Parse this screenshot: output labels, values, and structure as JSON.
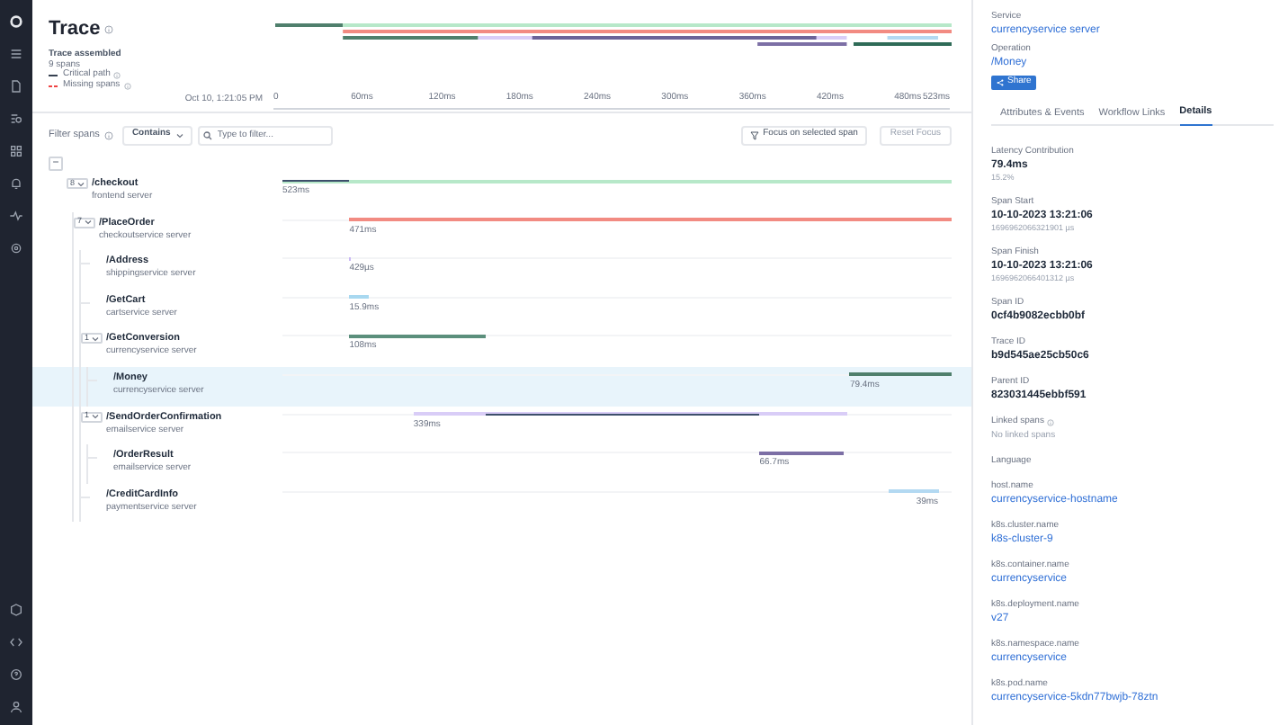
{
  "header": {
    "title": "Trace",
    "status": "Trace assembled",
    "span_count": "9 spans",
    "legend": [
      {
        "kind": "critical",
        "label": "Critical path"
      },
      {
        "kind": "missing",
        "label": "Missing spans"
      }
    ]
  },
  "timeline": {
    "start_time": "Oct 10, 1:21:05 PM",
    "ticks": [
      "0",
      "60ms",
      "120ms",
      "180ms",
      "240ms",
      "300ms",
      "360ms",
      "420ms",
      "480ms",
      "523ms"
    ]
  },
  "filter": {
    "label": "Filter spans",
    "mode": "Contains",
    "placeholder": "Type to filter...",
    "focus_button": "Focus on selected span",
    "reset_button": {
      "label": "Reset Focus",
      "disabled": true
    }
  },
  "collapse_all": "−",
  "spans": [
    {
      "name": "/checkout",
      "service": "frontend server",
      "count": "8",
      "expanded": true,
      "duration": "523ms",
      "color": "#b7e8c9",
      "selected": false,
      "children": [
        {
          "name": "/PlaceOrder",
          "service": "checkoutservice server",
          "count": "7",
          "expanded": true,
          "duration": "471ms",
          "color": "#f28b82",
          "selected": false,
          "children": [
            {
              "name": "/Address",
              "service": "shippingservice server",
              "duration": "429µs",
              "color": "#c9b8f5",
              "selected": false
            },
            {
              "name": "/GetCart",
              "service": "cartservice server",
              "duration": "15.9ms",
              "color": "#a8d8f0",
              "selected": false
            },
            {
              "name": "/GetConversion",
              "service": "currencyservice server",
              "count": "1",
              "expanded": true,
              "duration": "108ms",
              "color": "#5b8f7c",
              "selected": false,
              "children": [
                {
                  "name": "/Money",
                  "service": "currencyservice server",
                  "duration": "79.4ms",
                  "color": "#4f7f6c",
                  "selected": true
                }
              ]
            },
            {
              "name": "/SendOrderConfirmation",
              "service": "emailservice server",
              "count": "1",
              "expanded": true,
              "duration": "339ms",
              "color": "#d9cdf7",
              "selected": false,
              "children": [
                {
                  "name": "/OrderResult",
                  "service": "emailservice server",
                  "duration": "66.7ms",
                  "color": "#7c6fa5",
                  "selected": false
                }
              ]
            },
            {
              "name": "/CreditCardInfo",
              "service": "paymentservice server",
              "duration": "39ms",
              "color": "#b3d9f2",
              "selected": false
            }
          ]
        }
      ]
    }
  ],
  "details": {
    "service_label": "Service",
    "service": "currencyservice server",
    "operation_label": "Operation",
    "operation": "/Money",
    "share": "Share",
    "tabs": [
      {
        "label": "Attributes & Events",
        "selected": false
      },
      {
        "label": "Workflow Links",
        "selected": false
      },
      {
        "label": "Details",
        "selected": true
      }
    ],
    "fields": [
      {
        "kind": "plain",
        "label": "Latency Contribution",
        "value": "79.4ms",
        "sub": "15.2%"
      },
      {
        "kind": "plain",
        "label": "Span Start",
        "value": "10-10-2023 13:21:06",
        "sub": "1696962066321901 µs"
      },
      {
        "kind": "plain",
        "label": "Span Finish",
        "value": "10-10-2023 13:21:06",
        "sub": "1696962066401312 µs"
      },
      {
        "kind": "plain",
        "label": "Span ID",
        "value": "0cf4b9082ecbb0bf"
      },
      {
        "kind": "plain",
        "label": "Trace ID",
        "value": "b9d545ae25cb50c6"
      },
      {
        "kind": "plain",
        "label": "Parent ID",
        "value": "823031445ebbf591"
      },
      {
        "kind": "empty",
        "label": "Linked spans",
        "value": "No linked spans"
      },
      {
        "kind": "heading",
        "label": "Language"
      },
      {
        "kind": "link",
        "label": "host.name",
        "value": "currencyservice-hostname"
      },
      {
        "kind": "link",
        "label": "k8s.cluster.name",
        "value": "k8s-cluster-9"
      },
      {
        "kind": "link",
        "label": "k8s.container.name",
        "value": "currencyservice"
      },
      {
        "kind": "link",
        "label": "k8s.deployment.name",
        "value": "v27"
      },
      {
        "kind": "link",
        "label": "k8s.namespace.name",
        "value": "currencyservice"
      },
      {
        "kind": "link",
        "label": "k8s.pod.name",
        "value": "currencyservice-5kdn77bwjb-78ztn"
      }
    ]
  }
}
